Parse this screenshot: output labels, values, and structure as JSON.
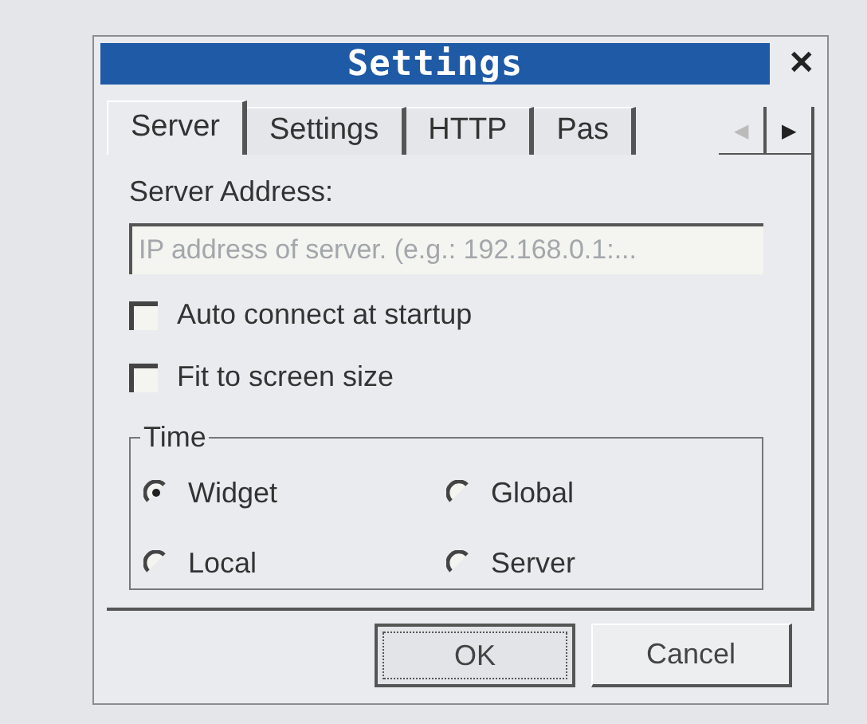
{
  "window": {
    "title": "Settings",
    "close": "✕"
  },
  "tabs": [
    {
      "label": "Server",
      "selected": true
    },
    {
      "label": "Settings",
      "selected": false
    },
    {
      "label": "HTTP",
      "selected": false
    },
    {
      "label": "Pas",
      "selected": false
    }
  ],
  "tab_scroll": {
    "left": "◀",
    "right": "▶",
    "left_disabled": true
  },
  "server_address": {
    "label": "Server Address:",
    "placeholder": "IP address of server. (e.g.: 192.168.0.1:..."
  },
  "checkboxes": [
    {
      "label": "Auto connect at startup",
      "checked": false
    },
    {
      "label": "Fit to screen size",
      "checked": false
    }
  ],
  "time": {
    "title": "Time",
    "options": [
      {
        "label": "Widget",
        "selected": true
      },
      {
        "label": "Global",
        "selected": false
      },
      {
        "label": "Local",
        "selected": false
      },
      {
        "label": "Server",
        "selected": false
      }
    ]
  },
  "buttons": [
    {
      "label": "OK",
      "focused": true
    },
    {
      "label": "Cancel",
      "focused": false
    }
  ]
}
